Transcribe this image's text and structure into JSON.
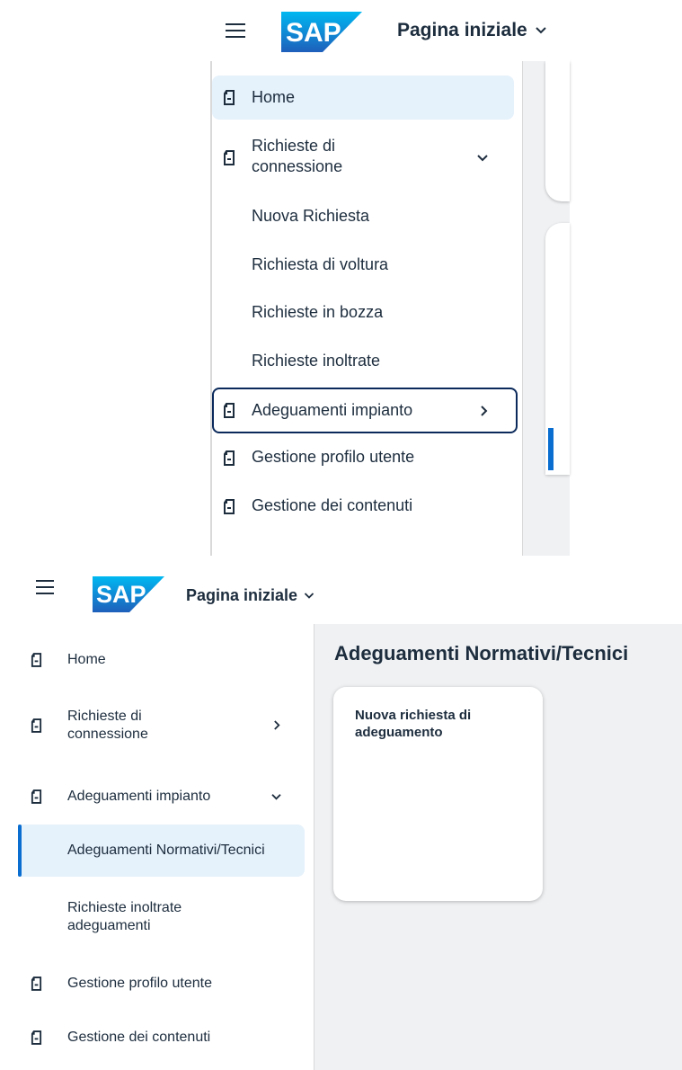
{
  "top_screenshot": {
    "shellbar": {
      "menu_icon": "hamburger-icon",
      "logo_text": "SAP",
      "title": "Pagina iniziale",
      "title_chevron": "chevron-down-icon"
    },
    "nav": {
      "items": [
        {
          "label": "Home",
          "icon": "document-icon",
          "selected": true
        },
        {
          "label_line1": "Richieste di",
          "label_line2": "connessione",
          "icon": "document-icon",
          "chevron": "chevron-down-icon",
          "expanded": true
        },
        {
          "label": "Nuova Richiesta"
        },
        {
          "label": "Richiesta di voltura"
        },
        {
          "label": "Richieste in bozza"
        },
        {
          "label": "Richieste inoltrate"
        },
        {
          "label": "Adeguamenti impianto",
          "icon": "document-icon",
          "chevron": "chevron-right-icon",
          "focused": true
        },
        {
          "label": "Gestione profilo utente",
          "icon": "document-icon"
        },
        {
          "label": "Gestione dei contenuti",
          "icon": "document-icon"
        }
      ]
    }
  },
  "bottom_screenshot": {
    "shellbar": {
      "menu_icon": "hamburger-icon",
      "logo_text": "SAP",
      "title": "Pagina iniziale",
      "title_chevron": "chevron-down-icon"
    },
    "nav": {
      "items": [
        {
          "label": "Home",
          "icon": "document-icon"
        },
        {
          "label_line1": "Richieste di",
          "label_line2": "connessione",
          "icon": "document-icon",
          "chevron": "chevron-right-icon"
        },
        {
          "label": "Adeguamenti impianto",
          "icon": "document-icon",
          "chevron": "chevron-down-icon",
          "expanded": true
        },
        {
          "label": "Adeguamenti Normativi/Tecnici",
          "selected": true
        },
        {
          "label_line1": "Richieste inoltrate",
          "label_line2": "adeguamenti"
        },
        {
          "label": "Gestione profilo utente",
          "icon": "document-icon"
        },
        {
          "label": "Gestione dei contenuti",
          "icon": "document-icon"
        }
      ]
    },
    "page_title": "Adeguamenti Normativi/Tecnici",
    "tile": {
      "title_line1": "Nuova richiesta di",
      "title_line2": "adeguamento"
    }
  },
  "colors": {
    "sap_blue": "#0a6ed1",
    "selected_bg": "#e5f1fb",
    "focus_border": "#0b2a5b",
    "text": "#1d2d3e",
    "content_bg": "#eff1f3"
  }
}
